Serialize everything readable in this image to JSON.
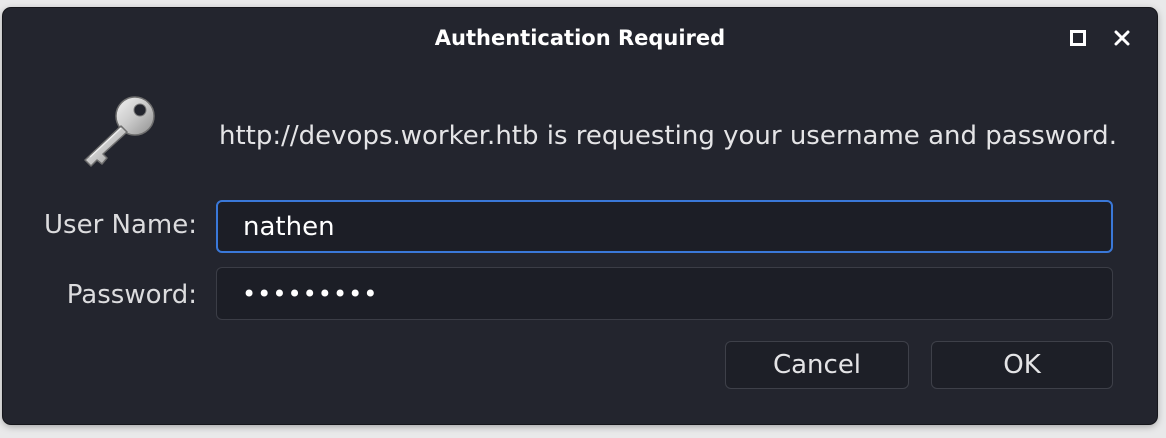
{
  "dialog": {
    "title": "Authentication Required",
    "message": "http://devops.worker.htb is requesting your username and password.",
    "icons": {
      "maximize": "maximize-icon",
      "close": "close-icon",
      "key": "key-icon"
    }
  },
  "form": {
    "username_label": "User Name:",
    "username_value": "nathen",
    "password_label": "Password:",
    "password_value": "•••••••••"
  },
  "buttons": {
    "cancel": "Cancel",
    "ok": "OK"
  },
  "colors": {
    "background": "#23252e",
    "focus_border": "#3a78d8",
    "text": "#ffffff"
  }
}
